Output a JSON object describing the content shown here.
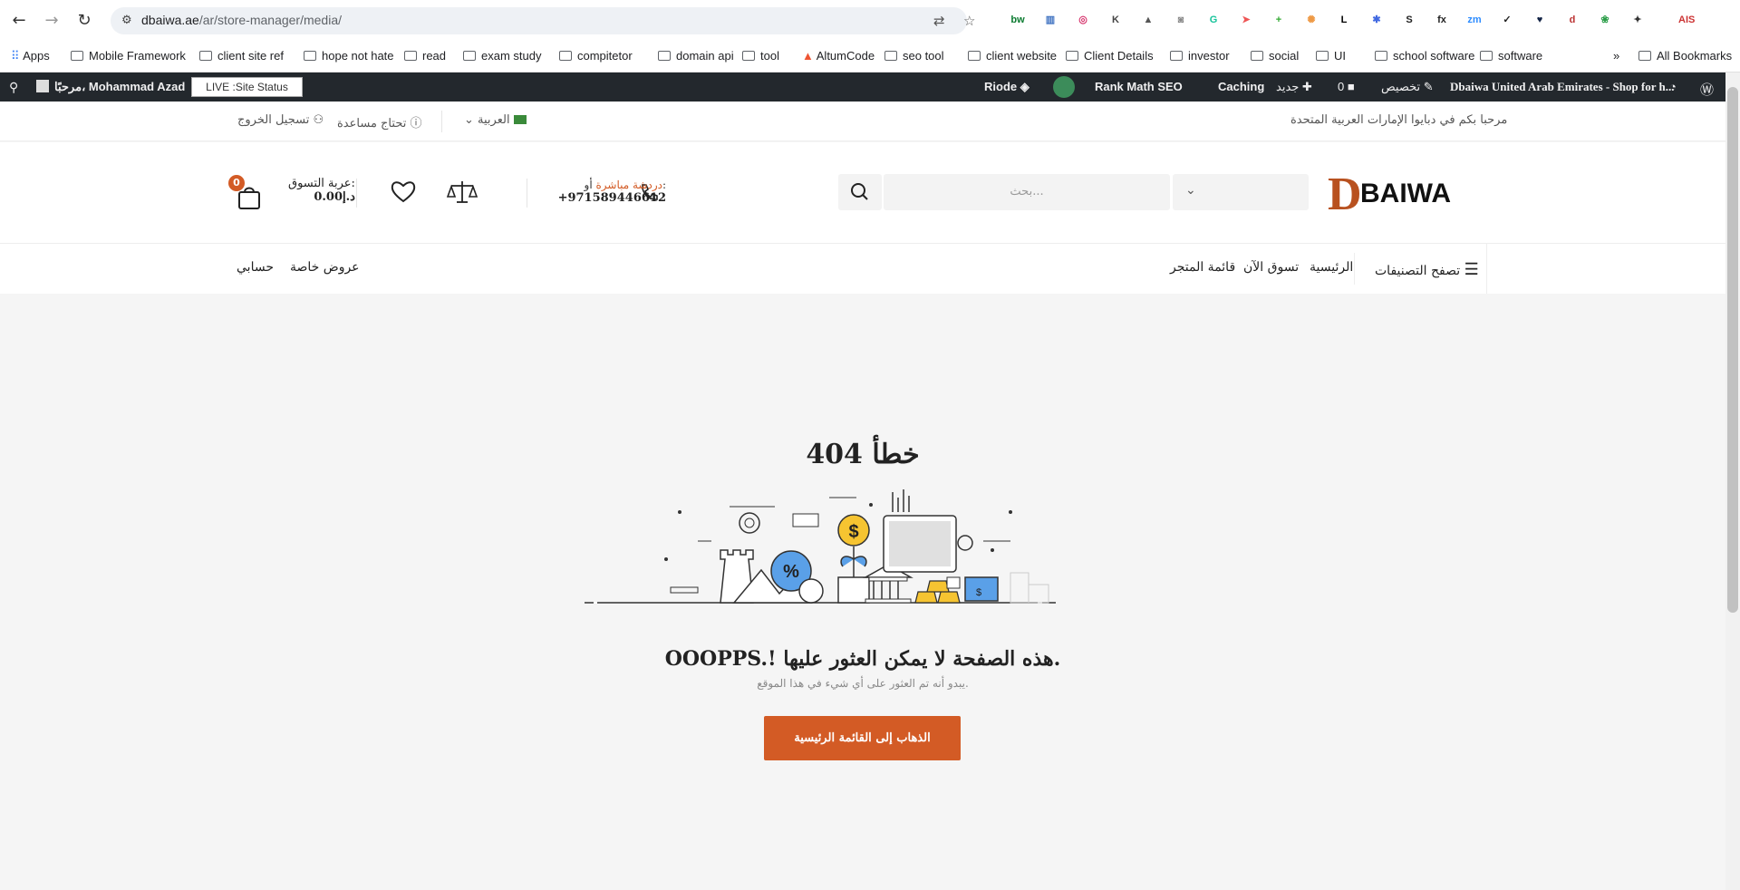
{
  "browser": {
    "url_host": "dbaiwa.ae",
    "url_path": "/ar/store-manager/media/",
    "extensions": [
      {
        "icon": "bw",
        "color": "#0a7a2f"
      },
      {
        "icon": "bars",
        "color": "#3b6fc0"
      },
      {
        "icon": "ring",
        "color": "#d6336c"
      },
      {
        "icon": "k-circle",
        "color": "#444"
      },
      {
        "icon": "triangle",
        "color": "#555"
      },
      {
        "icon": "camera",
        "color": "#888"
      },
      {
        "icon": "g-circle",
        "color": "#15c39a"
      },
      {
        "icon": "arrow",
        "color": "#e55"
      },
      {
        "icon": "plus-leaf",
        "color": "#3a3"
      },
      {
        "icon": "colorwheel",
        "color": "#e94"
      },
      {
        "icon": "L",
        "color": "#000"
      },
      {
        "icon": "gear-blue",
        "color": "#4169e1"
      },
      {
        "icon": "S",
        "color": "#222"
      },
      {
        "icon": "fx",
        "color": "#222"
      },
      {
        "icon": "zm",
        "color": "#2d8cff"
      },
      {
        "icon": "check",
        "color": "#222"
      },
      {
        "icon": "heart",
        "color": "#124"
      },
      {
        "icon": "desc",
        "color": "#b33"
      },
      {
        "icon": "leaf",
        "color": "#2a9d48"
      },
      {
        "icon": "puzzle",
        "color": "#333"
      },
      {
        "icon": "ais",
        "color": "#c33"
      }
    ]
  },
  "bookmarks": {
    "items": [
      "Apps",
      "Mobile Framework",
      "client site ref",
      "hope not hate",
      "read",
      "exam study",
      "compitetor",
      "domain api",
      "tool",
      "AltumCode",
      "seo tool",
      "client website",
      "Client Details",
      "investor",
      "social",
      "UI",
      "school software",
      "software"
    ],
    "more": "»",
    "all": "All Bookmarks"
  },
  "adminbar": {
    "greeting": "مرحبًا، Mohammad Azad",
    "live": "LIVE :Site Status",
    "riode": "Riode",
    "rankmath": "Rank Math SEO",
    "caching": "Caching",
    "new": "جديد",
    "comments": "0",
    "customize": "تخصيص",
    "site": "Dbaiwa United Arab Emirates - Shop for h..."
  },
  "topbar": {
    "welcome": "مرحبا بكم في دبايوا الإمارات العربية المتحدة",
    "language": "العربية",
    "help": "تحتاج مساعدة",
    "logout": "تسجيل الخروج"
  },
  "header": {
    "logo_text": "BAIWA",
    "search_placeholder": "بحث...",
    "contact_line1_a": "دردشة مباشرة",
    "contact_line1_b": " أو:",
    "contact_phone": "+971589446612",
    "cart_label": "عربة التسوق:",
    "cart_total": "0.00د.إ",
    "cart_count": "0"
  },
  "nav": {
    "categories": "تصفح التصنيفات",
    "home": "الرئيسية",
    "shop_now": "تسوق الآن",
    "store_list": "قائمة المتجر",
    "special_offers": "عروض خاصة",
    "my_account": "حسابي"
  },
  "error": {
    "title": "خطأ 404",
    "message": "OOOPPS.! هذه الصفحة لا يمكن العثور عليها.",
    "sub": "يبدو أنه تم العثور على أي شيء في هذا الموقع.",
    "button": "الذهاب إلى القائمة الرئيسية"
  },
  "colors": {
    "accent": "#d35b25",
    "adminbar": "#23282d"
  }
}
